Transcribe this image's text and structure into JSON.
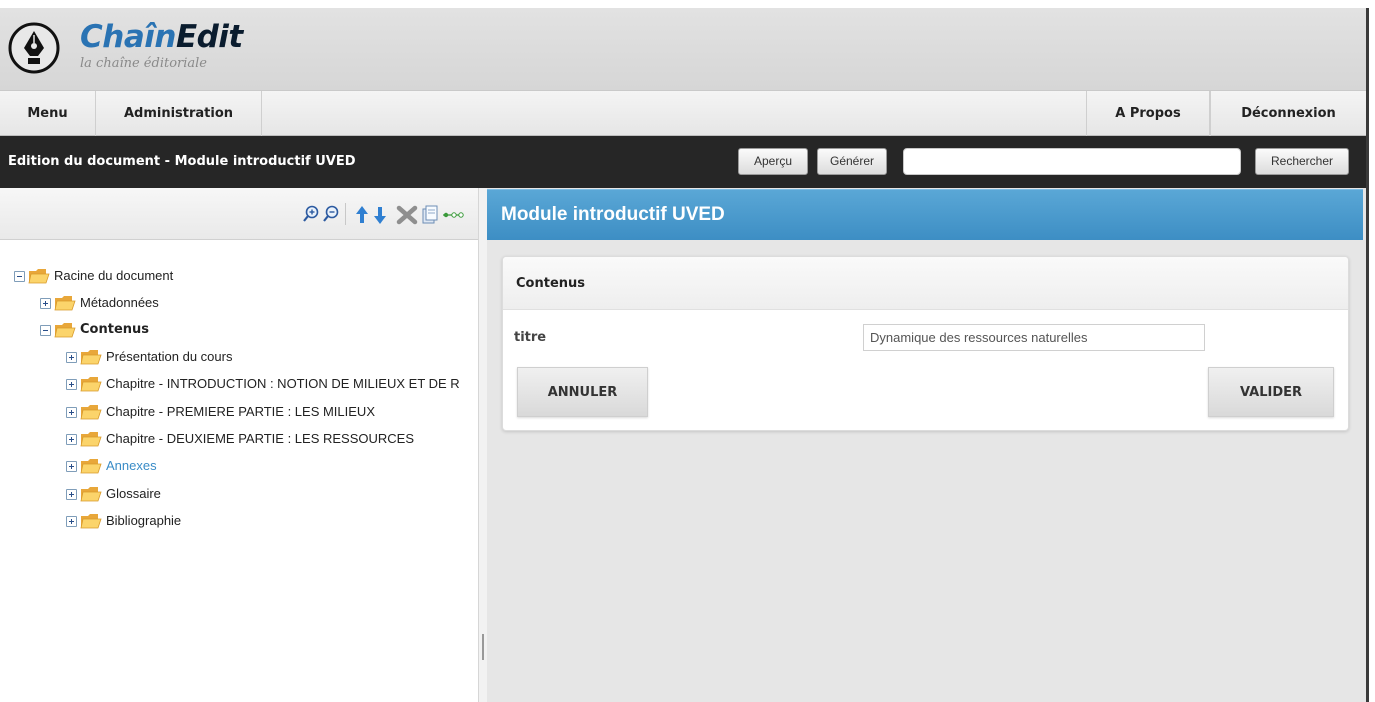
{
  "app": {
    "logo_title_part1": "Chaîn",
    "logo_title_part2": "Edit",
    "logo_subtitle": "la chaîne éditoriale"
  },
  "menubar": {
    "items": [
      {
        "label": "Menu"
      },
      {
        "label": "Administration"
      },
      {
        "label": "A Propos"
      },
      {
        "label": "Déconnexion"
      }
    ]
  },
  "toolbar": {
    "document_title": "Edition du document - Module introductif UVED",
    "apercu_label": "Aperçu",
    "generer_label": "Générer",
    "search_value": "",
    "rechercher_label": "Rechercher"
  },
  "tree": {
    "nodes": [
      {
        "label": "Racine du document",
        "expanded": true,
        "level": 0
      },
      {
        "label": "Métadonnées",
        "expanded": false,
        "level": 1
      },
      {
        "label": "Contenus",
        "expanded": true,
        "level": 1,
        "bold": true
      },
      {
        "label": "Présentation du cours",
        "expanded": false,
        "level": 2
      },
      {
        "label": "Chapitre - INTRODUCTION : NOTION DE MILIEUX ET DE R",
        "expanded": false,
        "level": 2
      },
      {
        "label": "Chapitre - PREMIERE PARTIE : LES MILIEUX",
        "expanded": false,
        "level": 2
      },
      {
        "label": "Chapitre - DEUXIEME PARTIE : LES RESSOURCES",
        "expanded": false,
        "level": 2
      },
      {
        "label": "Annexes",
        "expanded": false,
        "level": 2,
        "link": true
      },
      {
        "label": "Glossaire",
        "expanded": false,
        "level": 2
      },
      {
        "label": "Bibliographie",
        "expanded": false,
        "level": 2
      }
    ]
  },
  "editor": {
    "title": "Module introductif UVED",
    "section_title": "Contenus",
    "field_label": "titre",
    "field_value": "Dynamique des ressources naturelles",
    "cancel_label": "ANNULER",
    "submit_label": "VALIDER"
  },
  "colors": {
    "accent_blue": "#4a9bd0",
    "dark_bar": "#262626",
    "logo_blue": "#2a73b3",
    "link_blue": "#3a8cc7"
  }
}
